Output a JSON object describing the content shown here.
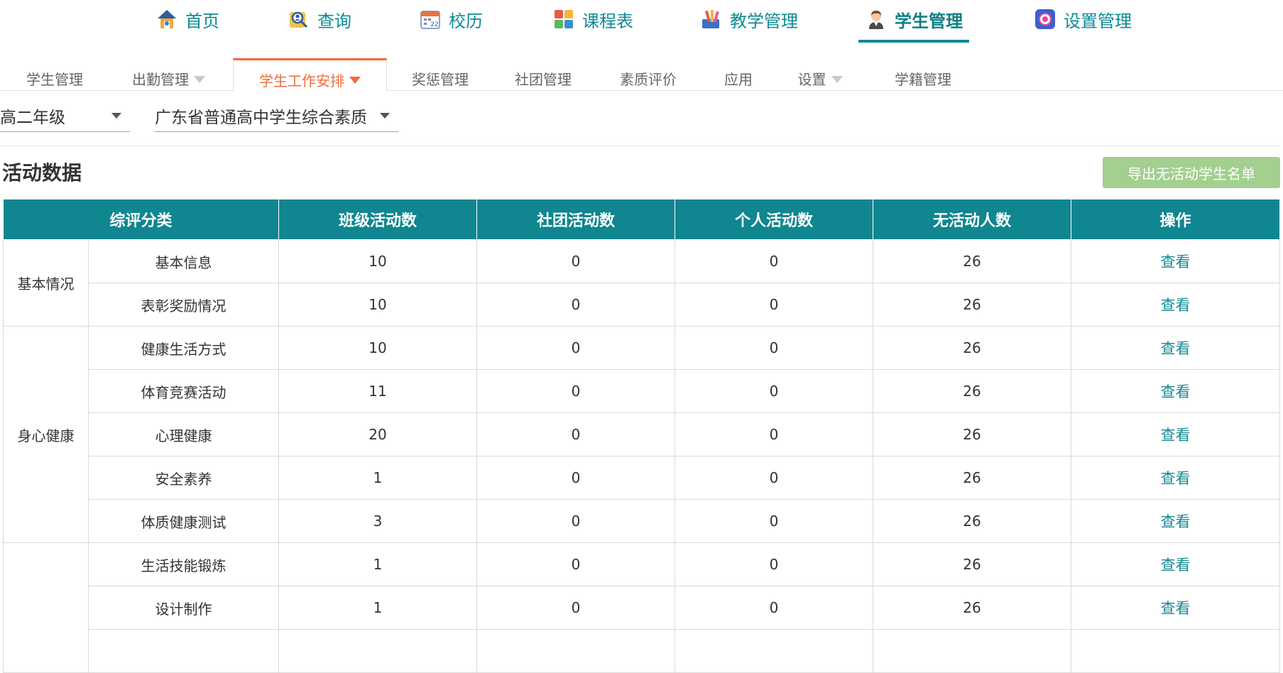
{
  "top_nav": {
    "items": [
      {
        "label": "首页",
        "icon": "home-icon"
      },
      {
        "label": "查询",
        "icon": "search-person-icon"
      },
      {
        "label": "校历",
        "icon": "calendar-icon"
      },
      {
        "label": "课程表",
        "icon": "timetable-icon"
      },
      {
        "label": "教学管理",
        "icon": "teaching-icon"
      },
      {
        "label": "学生管理",
        "icon": "student-icon",
        "active": true
      },
      {
        "label": "设置管理",
        "icon": "gear-icon"
      }
    ],
    "accent_color": "#0d8a93"
  },
  "sub_tabs": {
    "items": [
      {
        "label": "学生管理",
        "has_dropdown": false
      },
      {
        "label": "出勤管理",
        "has_dropdown": true
      },
      {
        "label": "学生工作安排",
        "has_dropdown": true,
        "active": true
      },
      {
        "label": "奖惩管理",
        "has_dropdown": false
      },
      {
        "label": "社团管理",
        "has_dropdown": false
      },
      {
        "label": "素质评价",
        "has_dropdown": false
      },
      {
        "label": "应用",
        "has_dropdown": false
      },
      {
        "label": "设置",
        "has_dropdown": true
      },
      {
        "label": "学籍管理",
        "has_dropdown": false
      }
    ],
    "active_color": "#f26b3a"
  },
  "filters": {
    "grade": "高二年级",
    "evaluation_scheme": "广东省普通高中学生综合素质"
  },
  "section": {
    "title": "活动数据",
    "export_button_label": "导出无活动学生名单",
    "export_button_color": "#a3cf8f"
  },
  "table": {
    "headers": [
      "综评分类",
      "班级活动数",
      "社团活动数",
      "个人活动数",
      "无活动人数",
      "操作"
    ],
    "header_color": "#0f8690",
    "groups": [
      {
        "name": "基本情况",
        "rows": [
          {
            "sub": "基本信息",
            "class_count": "10",
            "club_count": "0",
            "personal_count": "0",
            "no_activity": "26",
            "action": "查看"
          },
          {
            "sub": "表彰奖励情况",
            "class_count": "10",
            "club_count": "0",
            "personal_count": "0",
            "no_activity": "26",
            "action": "查看"
          }
        ]
      },
      {
        "name": "身心健康",
        "rows": [
          {
            "sub": "健康生活方式",
            "class_count": "10",
            "club_count": "0",
            "personal_count": "0",
            "no_activity": "26",
            "action": "查看"
          },
          {
            "sub": "体育竞赛活动",
            "class_count": "11",
            "club_count": "0",
            "personal_count": "0",
            "no_activity": "26",
            "action": "查看"
          },
          {
            "sub": "心理健康",
            "class_count": "20",
            "club_count": "0",
            "personal_count": "0",
            "no_activity": "26",
            "action": "查看"
          },
          {
            "sub": "安全素养",
            "class_count": "1",
            "club_count": "0",
            "personal_count": "0",
            "no_activity": "26",
            "action": "查看"
          },
          {
            "sub": "体质健康测试",
            "class_count": "3",
            "club_count": "0",
            "personal_count": "0",
            "no_activity": "26",
            "action": "查看"
          }
        ]
      },
      {
        "name": "",
        "rows": [
          {
            "sub": "生活技能锻炼",
            "class_count": "1",
            "club_count": "0",
            "personal_count": "0",
            "no_activity": "26",
            "action": "查看"
          },
          {
            "sub": "设计制作",
            "class_count": "1",
            "club_count": "0",
            "personal_count": "0",
            "no_activity": "26",
            "action": "查看"
          }
        ]
      }
    ]
  }
}
